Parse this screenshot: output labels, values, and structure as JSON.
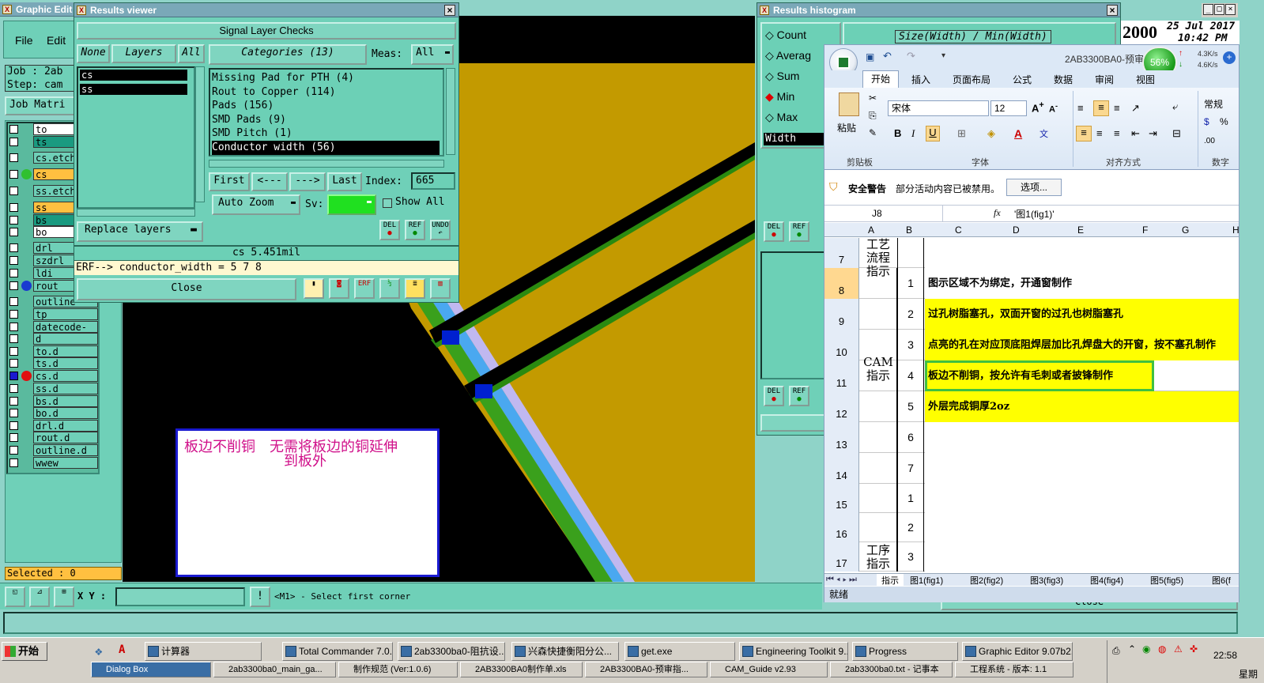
{
  "main_window": {
    "title": "Graphic Edit",
    "menu": [
      "File",
      "Edit"
    ],
    "job_label": "Job : 2ab",
    "step_label": "Step: cam",
    "job_matrix": "Job Matri",
    "selected": "Selected : 0",
    "xy_label": "X Y :",
    "xy_value": "",
    "status_msg": "<M1> - Select first corner",
    "layers": [
      {
        "name": "to",
        "color": "#ffffff"
      },
      {
        "name": "ts",
        "color": "#1a9a80"
      },
      {
        "name": "cs.etch",
        "color": "#6fd0b8"
      },
      {
        "name": "cs",
        "color": "#ffc040"
      },
      {
        "name": "ss.etch",
        "color": "#6fd0b8"
      },
      {
        "name": "ss",
        "color": "#ffc040"
      },
      {
        "name": "bs",
        "color": "#1a9a80"
      },
      {
        "name": "bo",
        "color": "#ffffff"
      },
      {
        "name": "drl",
        "color": "#6fd0b8"
      },
      {
        "name": "szdrl",
        "color": "#6fd0b8"
      },
      {
        "name": "ldi",
        "color": "#6fd0b8"
      },
      {
        "name": "rout",
        "color": "#6fd0b8"
      },
      {
        "name": "outline",
        "color": "#6fd0b8"
      },
      {
        "name": "tp",
        "color": "#6fd0b8"
      },
      {
        "name": "datecode-ptc",
        "color": "#6fd0b8"
      },
      {
        "name": "d",
        "color": "#6fd0b8"
      },
      {
        "name": "to.d",
        "color": "#6fd0b8"
      },
      {
        "name": "ts.d",
        "color": "#6fd0b8"
      },
      {
        "name": "cs.d",
        "color": "#6fd0b8"
      },
      {
        "name": "ss.d",
        "color": "#6fd0b8"
      },
      {
        "name": "bs.d",
        "color": "#6fd0b8"
      },
      {
        "name": "bo.d",
        "color": "#6fd0b8"
      },
      {
        "name": "drl.d",
        "color": "#6fd0b8"
      },
      {
        "name": "rout.d",
        "color": "#6fd0b8"
      },
      {
        "name": "outline.d",
        "color": "#6fd0b8"
      },
      {
        "name": "wwew",
        "color": "#6fd0b8"
      }
    ]
  },
  "note": {
    "line1": "板边不削铜　无需将板边的铜延伸",
    "line2": "到板外"
  },
  "results_viewer": {
    "title": "Results viewer",
    "heading": "Signal Layer Checks",
    "none_btn": "None",
    "layers_btn": "Layers",
    "all_btn": "All",
    "categories_label": "Categories (13)",
    "meas_label": "Meas:",
    "meas_value": "All",
    "layer_list": [
      "cs",
      "ss"
    ],
    "categories": [
      "Missing Pad for PTH (4)",
      "Rout to Copper (114)",
      "Pads (156)",
      "SMD Pads (9)",
      "SMD Pitch (1)",
      "Conductor width (56)"
    ],
    "nav": {
      "first": "First",
      "prev": "<---",
      "next": "--->",
      "last": "Last",
      "index_label": "Index:",
      "index_value": "665"
    },
    "auto_zoom": "Auto Zoom",
    "sv_label": "Sv:",
    "show_all": "Show All",
    "replace_layers": "Replace layers",
    "del_label": "DEL",
    "ref_label": "REF",
    "undo_label": "UNDO",
    "status_value": "cs 5.451mil",
    "erf_line": "ERF--> conductor_width = 5 7 8",
    "close": "Close"
  },
  "histogram": {
    "title": "Results histogram",
    "options": [
      "Count",
      "Averag",
      "Sum",
      "Min",
      "Max"
    ],
    "selected_option": "Min",
    "header": "Size(Width) / Min(Width)",
    "field": "Width",
    "del_label": "DEL",
    "ref_label": "REF",
    "close": "Close"
  },
  "clock": {
    "year": "2000",
    "date": "25 Jul 2017",
    "time": "10:42 PM"
  },
  "excel": {
    "title": "2AB3300BA0-预审",
    "tabs": [
      "开始",
      "插入",
      "页面布局",
      "公式",
      "数据",
      "审阅",
      "视图"
    ],
    "font_name": "宋体",
    "font_size": "12",
    "number_format": "常规",
    "groups": [
      "剪贴板",
      "字体",
      "对齐方式",
      "数字"
    ],
    "paste": "粘贴",
    "security_label": "安全警告",
    "security_msg": "部分活动内容已被禁用。",
    "options_btn": "选项...",
    "cell_ref": "J8",
    "formula": "'图1(fig1)'",
    "fx": "fx",
    "col_headers": [
      "A",
      "B",
      "C",
      "D",
      "E",
      "F",
      "G",
      "H"
    ],
    "rows": [
      {
        "row": "7",
        "a": "工艺流程指示",
        "b": "",
        "c": ""
      },
      {
        "row": "8",
        "a": "",
        "b": "1",
        "c": "图示区域不为绑定，开通窗制作"
      },
      {
        "row": "9",
        "a": "",
        "b": "2",
        "c": "过孔树脂塞孔，双面开窗的过孔也树脂塞孔"
      },
      {
        "row": "10",
        "a": "",
        "b": "3",
        "c": "点亮的孔在对应顶底阻焊层加比孔焊盘大的开窗，按不塞孔制作"
      },
      {
        "row": "11",
        "a": "CAM指示",
        "b": "4",
        "c": "板边不削铜，按允许有毛刺或者披锋制作"
      },
      {
        "row": "12",
        "a": "",
        "b": "5",
        "c": "外层完成铜厚2oz"
      },
      {
        "row": "13",
        "a": "",
        "b": "6",
        "c": ""
      },
      {
        "row": "14",
        "a": "",
        "b": "7",
        "c": ""
      },
      {
        "row": "15",
        "a": "",
        "b": "1",
        "c": ""
      },
      {
        "row": "16",
        "a": "",
        "b": "2",
        "c": ""
      },
      {
        "row": "17",
        "a": "工序指示",
        "b": "3",
        "c": ""
      }
    ],
    "sheets": [
      "指示",
      "图1(fig1)",
      "图2(fig2)",
      "图3(fig3)",
      "图4(fig4)",
      "图5(fig5)",
      "图6(f"
    ],
    "status": "就绪",
    "net_percent": "56%",
    "net_up": "4.3K/s",
    "net_down": "4.6K/s"
  },
  "taskbar": {
    "start": "开始",
    "row1": [
      "计算器",
      "Total Commander 7.0...",
      "2ab3300ba0-阻抗设...",
      "兴森快捷衡阳分公...",
      "get.exe",
      "Engineering Toolkit 9....",
      "Progress",
      "Graphic Editor 9.07b2..."
    ],
    "row2": [
      "Dialog Box",
      "2ab3300ba0_main_ga...",
      "制作规范 (Ver:1.0.6)",
      "2AB3300BA0制作单.xls",
      "2AB3300BA0-预审指...",
      "CAM_Guide v2.93",
      "2ab3300ba0.txt - 记事本",
      "工程系统 - 版本: 1.1"
    ],
    "clock": "22:58",
    "day": "星期二"
  }
}
